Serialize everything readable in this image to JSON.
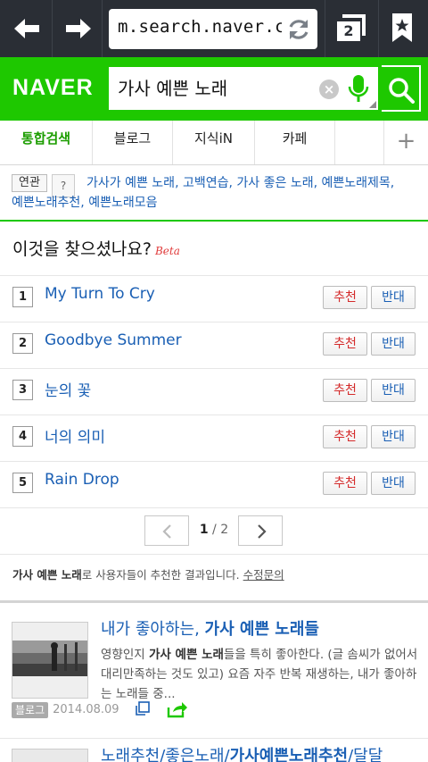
{
  "browser": {
    "url": "m.search.naver.com",
    "tab_count": "2"
  },
  "header": {
    "logo": "NAVER",
    "query": "가사 예쁜 노래",
    "clear_symbol": "×"
  },
  "tabs": [
    {
      "label": "통합검색",
      "active": true
    },
    {
      "label": "블로그",
      "active": false
    },
    {
      "label": "지식iN",
      "active": false
    },
    {
      "label": "카페",
      "active": false
    }
  ],
  "tabs_more": "+",
  "related": {
    "label": "연관",
    "help": "?",
    "links": [
      "가사가 예쁜 노래",
      "고백연습",
      "가사 좋은 노래",
      "예쁜노래제목",
      "예쁜노래추천",
      "예쁜노래모음"
    ]
  },
  "suggestions": {
    "title": "이것을 찾으셨나요?",
    "beta": "Beta",
    "items": [
      {
        "num": "1",
        "title": "My Turn To Cry"
      },
      {
        "num": "2",
        "title": "Goodbye Summer"
      },
      {
        "num": "3",
        "title": "눈의 꽃"
      },
      {
        "num": "4",
        "title": "너의 의미"
      },
      {
        "num": "5",
        "title": "Rain Drop"
      }
    ],
    "recommend_label": "추천",
    "oppose_label": "반대",
    "page_current": "1",
    "page_total": "2",
    "page_sep": " / ",
    "notice_query": "가사 예쁜 노래",
    "notice_text": "로 사용자들이 추천한 결과입니다.",
    "notice_link": "수정문의"
  },
  "blog_results": [
    {
      "title_plain": "내가 좋아하는, ",
      "title_bold": "가사 예쁜 노래들",
      "desc_1": "영향인지 ",
      "desc_bold": "가사 예쁜 노래",
      "desc_2": "들을 특히 좋아한다. (글 솜씨가 없어서 대리만족하는 것도 있고) 요즘 자주 반복 재생하는, 내가 좋아하는 노래들 중...",
      "badge": "블로그",
      "date": "2014.08.09"
    },
    {
      "title_plain": "노래추천/좋은노래/",
      "title_bold": "가사예쁜노래추천",
      "title_tail": "/달달"
    }
  ],
  "colors": {
    "naver_green": "#1ec800",
    "link_blue": "#1a5fb4",
    "recommend_red": "#d42b2b",
    "browser_bar": "#2a2e35"
  }
}
